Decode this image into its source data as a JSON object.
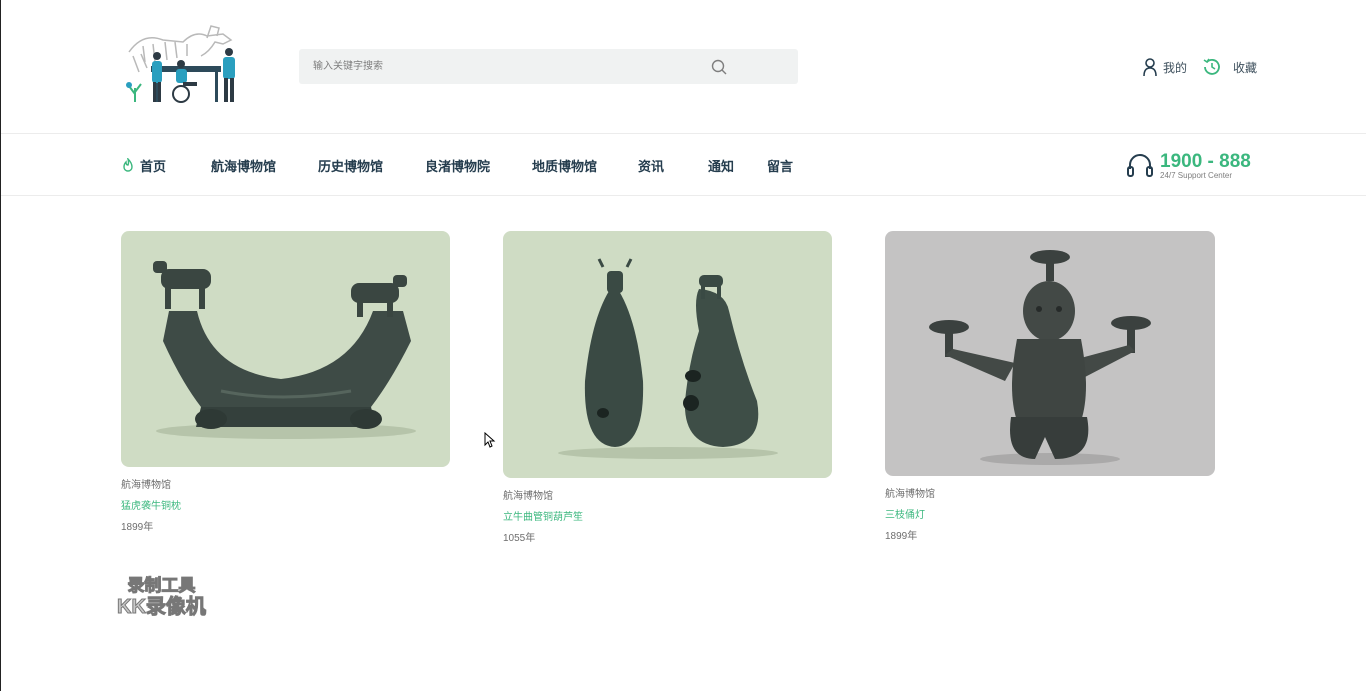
{
  "search": {
    "placeholder": "输入关键字搜索"
  },
  "header_actions": [
    {
      "label": "我的",
      "icon": "user-icon"
    },
    {
      "label": "收藏",
      "icon": "clock-history-icon"
    }
  ],
  "nav": {
    "items": [
      "首页",
      "航海博物馆",
      "历史博物馆",
      "良渚博物院",
      "地质博物馆",
      "资讯",
      "通知",
      "留言"
    ],
    "active": "首页"
  },
  "support": {
    "number": "1900 - 888",
    "subtitle": "24/7 Support Center"
  },
  "cards": [
    {
      "venue": "航海博物馆",
      "name": "猛虎袭牛铜枕",
      "year": "1899年"
    },
    {
      "venue": "航海博物馆",
      "name": "立牛曲管铜葫芦笙",
      "year": "1055年"
    },
    {
      "venue": "航海博物馆",
      "name": "三枝俑灯",
      "year": "1899年"
    }
  ],
  "watermark": {
    "line1": "录制工具",
    "line2": "KK录像机"
  },
  "colors": {
    "accent": "#3bb77e",
    "heading": "#253d4e",
    "card_bg_green": "#cfdcc4",
    "card_bg_gray": "#c4c3c3"
  }
}
